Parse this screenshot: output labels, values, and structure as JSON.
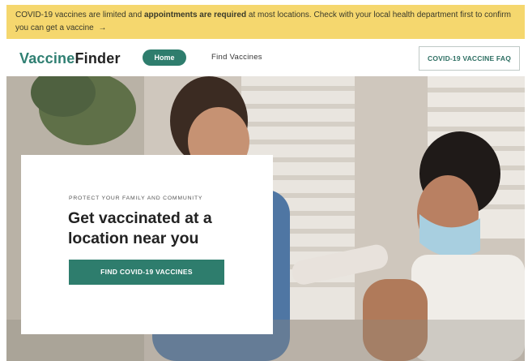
{
  "banner": {
    "text_before": "COVID-19 vaccines are limited and ",
    "text_bold": "appointments are required",
    "text_after": " at most locations. Check with your local health department first to confirm you can get a vaccine",
    "arrow": "→"
  },
  "header": {
    "logo_part1": "Vaccine",
    "logo_part2": "Finder",
    "home_label": "Home",
    "find_label": "Find Vaccines",
    "faq_label": "COVID-19 VACCINE FAQ"
  },
  "hero": {
    "eyebrow": "PROTECT YOUR FAMILY AND COMMUNITY",
    "title": "Get vaccinated at a location near you",
    "cta_label": "FIND COVID-19 VACCINES"
  },
  "colors": {
    "banner_bg": "#f5d76e",
    "brand_green": "#2e7d6d",
    "logo_green": "#2f7f72"
  }
}
